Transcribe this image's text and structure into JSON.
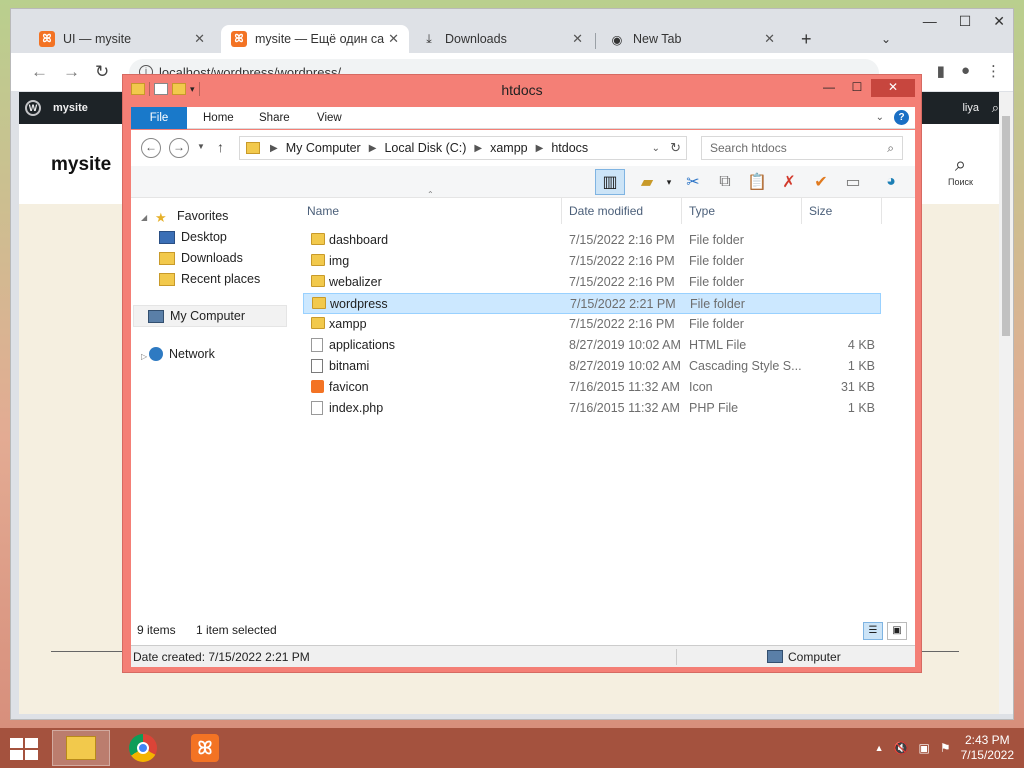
{
  "browser": {
    "tabs": [
      {
        "label": "UI — mysite",
        "icon": "xampp-icon"
      },
      {
        "label": "mysite — Ещё один са",
        "icon": "xampp-icon"
      },
      {
        "label": "Downloads",
        "icon": "download-icon"
      },
      {
        "label": "New Tab",
        "icon": "chrome-icon"
      }
    ],
    "new_tab_label": "+",
    "url": "localhost/wordpress/wordpress/"
  },
  "wordpress": {
    "adminbar_site": "mysite",
    "adminbar_user": "liya",
    "site_title": "mysite",
    "search_label": "Поиск"
  },
  "explorer": {
    "title": "htdocs",
    "ribbon_tabs": [
      "File",
      "Home",
      "Share",
      "View"
    ],
    "breadcrumb": [
      "My Computer",
      "Local Disk (C:)",
      "xampp",
      "htdocs"
    ],
    "search_placeholder": "Search htdocs",
    "nav": {
      "favorites": "Favorites",
      "desktop": "Desktop",
      "downloads": "Downloads",
      "recent": "Recent places",
      "computer": "My Computer",
      "network": "Network"
    },
    "columns": {
      "name": "Name",
      "date": "Date modified",
      "type": "Type",
      "size": "Size"
    },
    "files": [
      {
        "name": "dashboard",
        "date": "7/15/2022 2:16 PM",
        "type": "File folder",
        "size": "",
        "icon": "folder"
      },
      {
        "name": "img",
        "date": "7/15/2022 2:16 PM",
        "type": "File folder",
        "size": "",
        "icon": "folder"
      },
      {
        "name": "webalizer",
        "date": "7/15/2022 2:16 PM",
        "type": "File folder",
        "size": "",
        "icon": "folder"
      },
      {
        "name": "wordpress",
        "date": "7/15/2022 2:21 PM",
        "type": "File folder",
        "size": "",
        "icon": "folder",
        "selected": true
      },
      {
        "name": "xampp",
        "date": "7/15/2022 2:16 PM",
        "type": "File folder",
        "size": "",
        "icon": "folder"
      },
      {
        "name": "applications",
        "date": "8/27/2019 10:02 AM",
        "type": "HTML File",
        "size": "4 KB",
        "icon": "doc"
      },
      {
        "name": "bitnami",
        "date": "8/27/2019 10:02 AM",
        "type": "Cascading Style S...",
        "size": "1 KB",
        "icon": "css"
      },
      {
        "name": "favicon",
        "date": "7/16/2015 11:32 AM",
        "type": "Icon",
        "size": "31 KB",
        "icon": "fav"
      },
      {
        "name": "index.php",
        "date": "7/16/2015 11:32 AM",
        "type": "PHP File",
        "size": "1 KB",
        "icon": "doc"
      }
    ],
    "status": {
      "count": "9 items",
      "selection": "1 item selected"
    },
    "details": {
      "created": "Date created: 7/15/2022 2:21 PM",
      "location": "Computer"
    }
  },
  "taskbar": {
    "time": "2:43 PM",
    "date": "7/15/2022"
  }
}
